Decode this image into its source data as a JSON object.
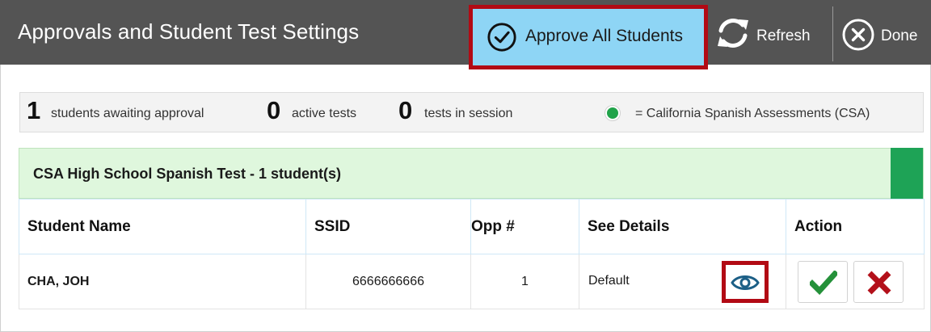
{
  "header": {
    "title": "Approvals and Student Test Settings",
    "approve_all_label": "Approve All Students",
    "refresh_label": "Refresh",
    "done_label": "Done"
  },
  "summary": {
    "awaiting_count": "1",
    "awaiting_label": "students awaiting approval",
    "active_count": "0",
    "active_label": "active tests",
    "session_count": "0",
    "session_label": "tests in session",
    "legend_label": "= California Spanish Assessments (CSA)",
    "legend_color": "#21a34a"
  },
  "group": {
    "title": "CSA High School Spanish Test - 1 student(s)",
    "accent_color": "#1ea356"
  },
  "table": {
    "headers": [
      "Student Name",
      "SSID",
      "Opp #",
      "See Details",
      "Action"
    ],
    "rows": [
      {
        "name": "CHA, JOH",
        "ssid": "6666666666",
        "opp": "1",
        "details": "Default"
      }
    ]
  },
  "icons": {
    "approve_all": "check-circle-icon",
    "refresh": "refresh-icon",
    "done": "close-circle-icon",
    "details": "eye-icon",
    "approve_row": "checkmark-icon",
    "deny_row": "x-mark-icon"
  },
  "colors": {
    "header_bg": "#545454",
    "approve_btn_bg": "#8ed5f5",
    "highlight_border": "#b20a14",
    "group_bg": "#dff7dd",
    "check_green": "#25913a",
    "deny_red": "#b3101a",
    "eye_blue": "#1c5f86"
  }
}
